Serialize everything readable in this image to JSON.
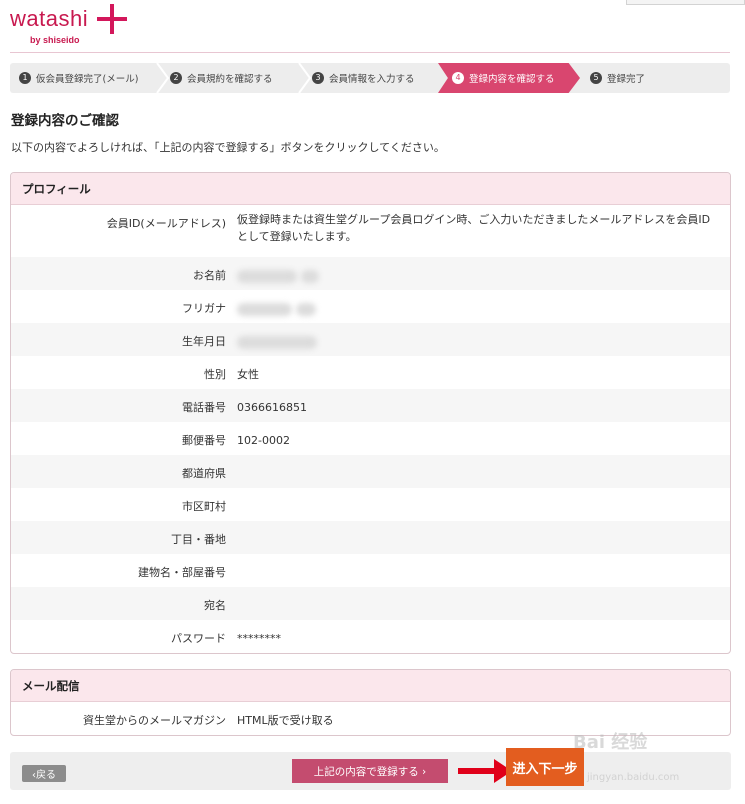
{
  "logo": {
    "word": "watashi",
    "sub": "by shiseido"
  },
  "steps": [
    {
      "num": "1",
      "label": "仮会員登録完了(メール)"
    },
    {
      "num": "2",
      "label": "会員規約を確認する"
    },
    {
      "num": "3",
      "label": "会員情報を入力する"
    },
    {
      "num": "4",
      "label": "登録内容を確認する",
      "active": true
    },
    {
      "num": "5",
      "label": "登録完了"
    }
  ],
  "page": {
    "title": "登録内容のご確認",
    "intro": "以下の内容でよろしければ、「上記の内容で登録する」ボタンをクリックしてください。"
  },
  "profile": {
    "heading": "プロフィール",
    "rows": [
      {
        "label": "会員ID(メールアドレス)",
        "value": "仮登録時または資生堂グループ会員ログイン時、ご入力いただきましたメールアドレスを会員IDとして登録いたします。"
      },
      {
        "label": "お名前",
        "value": ""
      },
      {
        "label": "フリガナ",
        "value": ""
      },
      {
        "label": "生年月日",
        "value": ""
      },
      {
        "label": "性別",
        "value": "女性"
      },
      {
        "label": "電話番号",
        "value": "0366616851"
      },
      {
        "label": "郵便番号",
        "value": "102-0002"
      },
      {
        "label": "都道府県",
        "value": ""
      },
      {
        "label": "市区町村",
        "value": ""
      },
      {
        "label": "丁目・番地",
        "value": ""
      },
      {
        "label": "建物名・部屋番号",
        "value": ""
      },
      {
        "label": "宛名",
        "value": ""
      },
      {
        "label": "パスワード",
        "value": "********"
      }
    ]
  },
  "mail": {
    "heading": "メール配信",
    "rows": [
      {
        "label": "資生堂からのメールマガジン",
        "value": "HTML版で受け取る"
      }
    ]
  },
  "footer": {
    "back_label": "‹戻る",
    "submit_label": "上記の内容で登録する ›",
    "next_label": "进入下一步"
  },
  "watermark": {
    "text": "Bai 经验",
    "url": "jingyan.baidu.com"
  },
  "colors": {
    "brand": "#c8194f",
    "step_active": "#d9466f",
    "panel_head": "#fbe7ec",
    "next_button": "#e35d1f",
    "arrow": "#e0001a"
  }
}
